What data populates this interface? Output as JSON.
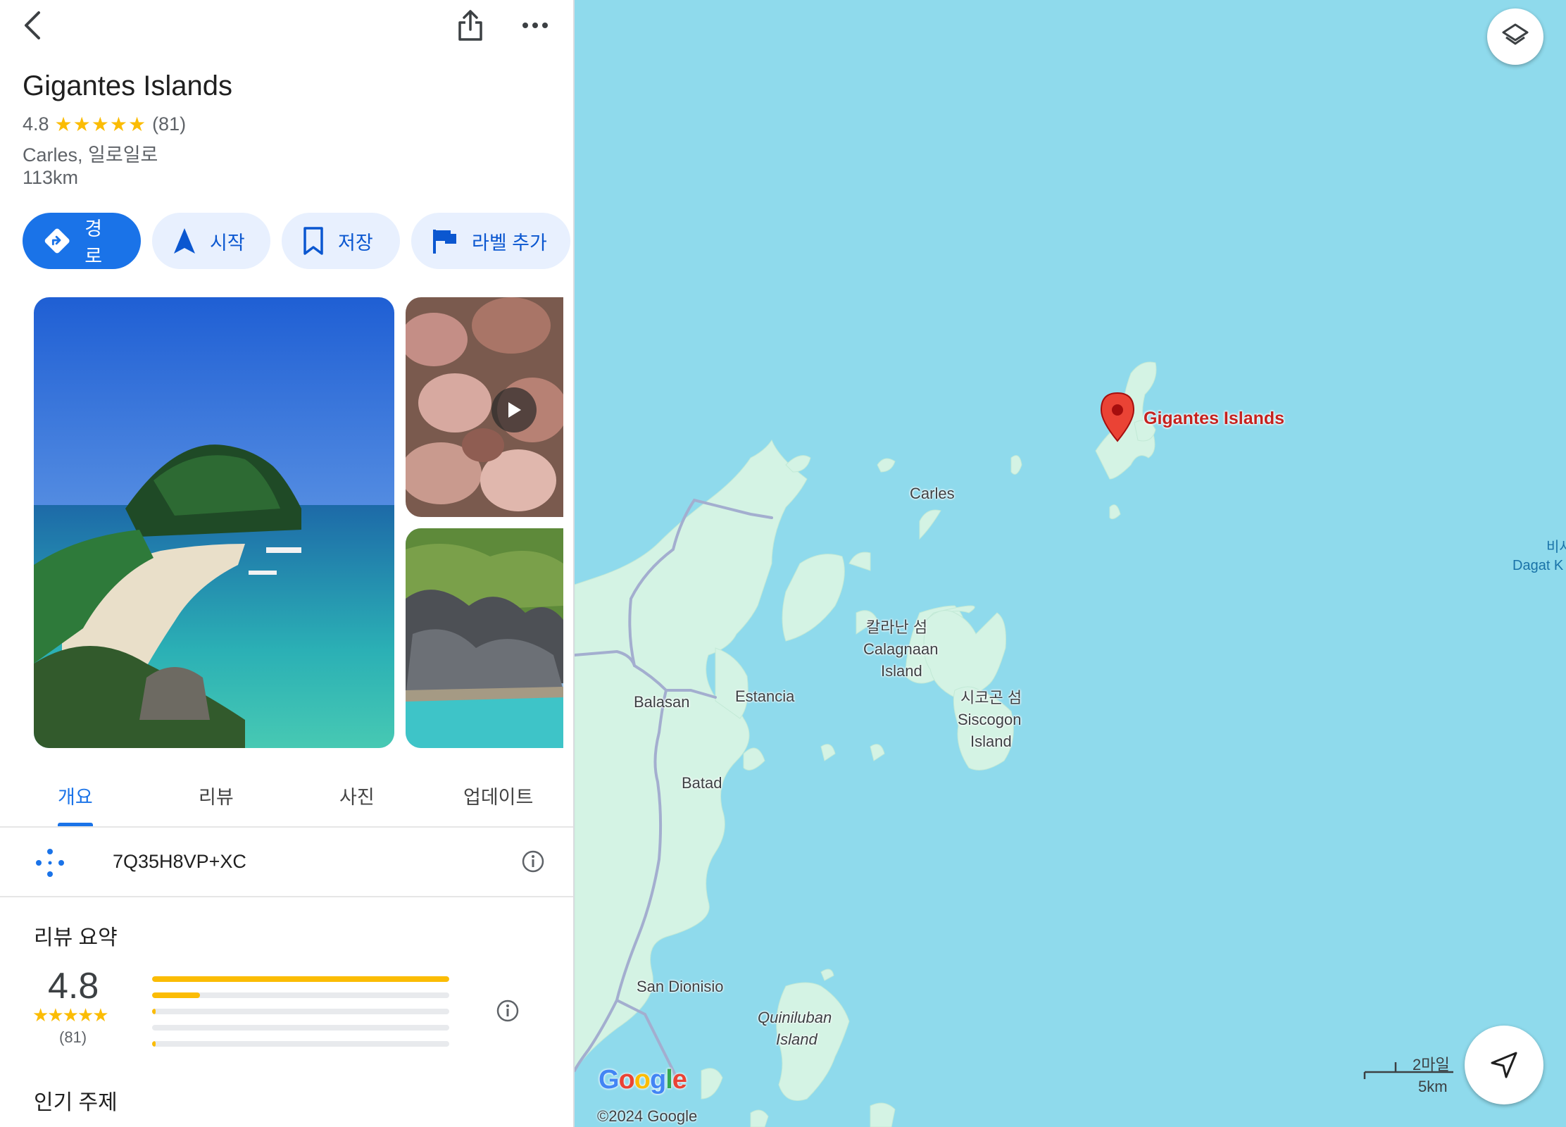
{
  "place": {
    "name": "Gigantes Islands",
    "rating": "4.8",
    "stars": "★★★★★",
    "review_count": "(81)",
    "address": "Carles, 일로일로",
    "distance": "113km"
  },
  "actions": [
    {
      "label": "경로",
      "icon": "directions-icon"
    },
    {
      "label": "시작",
      "icon": "navigation-arrow-icon"
    },
    {
      "label": "저장",
      "icon": "bookmark-icon"
    },
    {
      "label": "라벨 추가",
      "icon": "flag-icon"
    }
  ],
  "tabs": [
    "개요",
    "리뷰",
    "사진",
    "업데이트"
  ],
  "active_tab": "개요",
  "plus_code": "7Q35H8VP+XC",
  "review_summary": {
    "heading": "리뷰 요약",
    "rating": "4.8",
    "stars": "★★★★★",
    "count": "(81)",
    "distribution": [
      1.0,
      0.16,
      0.01,
      0.0,
      0.01
    ]
  },
  "popular_topics_heading": "인기 주제",
  "map": {
    "marker_label": "Gigantes Islands",
    "labels": {
      "carles": "Carles",
      "calagnaan_ko": "칼라난 섬",
      "calagnaan_1": "Calagnaan",
      "calagnaan_2": "Island",
      "siscogon_ko": "시코곤 섬",
      "siscogon_1": "Siscogon",
      "siscogon_2": "Island",
      "balasan": "Balasan",
      "estancia": "Estancia",
      "batad": "Batad",
      "san_dionisio": "San Dionisio",
      "quiniluban_1": "Quiniluban",
      "quiniluban_2": "Island",
      "sea_ko": "비사",
      "sea_en": "Dagat K"
    },
    "google_logo": "Google",
    "copyright": "©2024 Google",
    "scale_miles": "2마일",
    "scale_km": "5km"
  },
  "colors": {
    "accent": "#1a73e8",
    "star": "#fbbc04",
    "water": "#8fdaec",
    "land": "#d4f3e4",
    "marker": "#ea4335"
  }
}
